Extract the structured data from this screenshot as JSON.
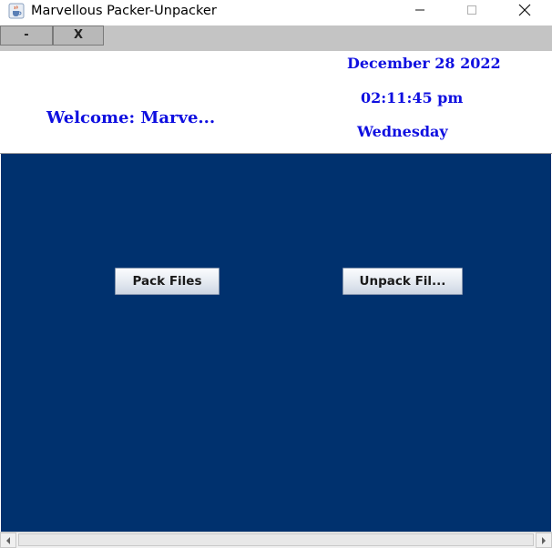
{
  "window": {
    "title": "Marvellous Packer-Unpacker",
    "icon": "java-cup-icon"
  },
  "toolbar": {
    "minimize_label": "-",
    "close_label": "X"
  },
  "header": {
    "welcome": "Welcome: Marve...",
    "date": "December 28 2022",
    "time": "02:11:45 pm",
    "day": "Wednesday",
    "text_color": "#0f0fe0"
  },
  "main": {
    "background": "#00316e",
    "pack_button": "Pack Files",
    "unpack_button": "Unpack Fil..."
  }
}
